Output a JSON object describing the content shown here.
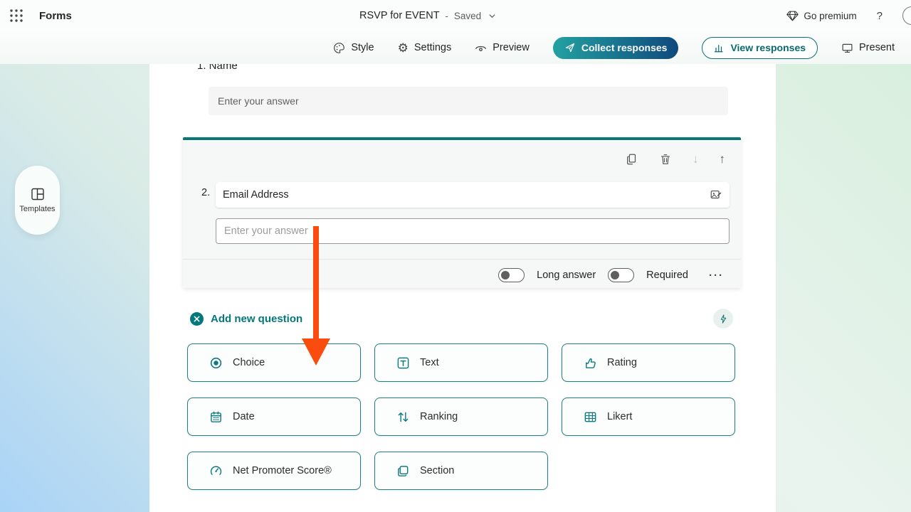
{
  "header": {
    "app_name": "Forms",
    "form_title": "RSVP for EVENT",
    "title_separator": "-",
    "save_status": "Saved",
    "go_premium_label": "Go premium",
    "help_label": "?"
  },
  "toolbar": {
    "style_label": "Style",
    "settings_label": "Settings",
    "preview_label": "Preview",
    "collect_responses_label": "Collect responses",
    "view_responses_label": "View responses",
    "present_label": "Present"
  },
  "templates": {
    "label": "Templates"
  },
  "form": {
    "question1": {
      "title": "1. Name",
      "placeholder": "Enter your answer"
    },
    "question2": {
      "number": "2.",
      "title": "Email Address",
      "placeholder": "Enter your answer",
      "long_answer_label": "Long answer",
      "required_label": "Required",
      "more_options": "···"
    },
    "add_new_question_label": "Add new question",
    "question_types": [
      {
        "label": "Choice",
        "icon": "radio-icon"
      },
      {
        "label": "Text",
        "icon": "text-icon"
      },
      {
        "label": "Rating",
        "icon": "thumbs-up-icon"
      },
      {
        "label": "Date",
        "icon": "calendar-icon"
      },
      {
        "label": "Ranking",
        "icon": "ranking-arrows-icon"
      },
      {
        "label": "Likert",
        "icon": "likert-grid-icon"
      },
      {
        "label": "Net Promoter Score®",
        "icon": "gauge-icon"
      },
      {
        "label": "Section",
        "icon": "section-pages-icon"
      }
    ]
  },
  "colors": {
    "accent_teal": "#03787c",
    "collect_gradient_start": "#23a1a1",
    "collect_gradient_end": "#0f4a7d",
    "annotation_arrow_orange": "#fb4c10",
    "background_blue": "#a9d3f7",
    "background_green": "#d6eedc"
  }
}
